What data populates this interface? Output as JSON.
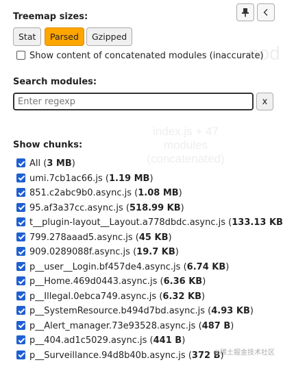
{
  "header": {
    "pin_icon": "pin-icon",
    "collapse_icon": "chevron-left-icon"
  },
  "treemap": {
    "title": "Treemap sizes:",
    "buttons": [
      {
        "label": "Stat",
        "active": false
      },
      {
        "label": "Parsed",
        "active": true
      },
      {
        "label": "Gzipped",
        "active": false
      }
    ],
    "concat_option": {
      "label": "Show content of concatenated modules (inaccurate)",
      "checked": false
    }
  },
  "search": {
    "title": "Search modules:",
    "placeholder": "Enter regexp",
    "value": "",
    "clear_label": "x"
  },
  "chunks": {
    "title": "Show chunks:",
    "items": [
      {
        "name": "All",
        "size": "3 MB",
        "checked": true
      },
      {
        "name": "umi.7cb1ac66.js",
        "size": "1.19 MB",
        "checked": true
      },
      {
        "name": "851.c2abc9b0.async.js",
        "size": "1.08 MB",
        "checked": true
      },
      {
        "name": "95.af3a37cc.async.js",
        "size": "518.99 KB",
        "checked": true
      },
      {
        "name": "t__plugin-layout__Layout.a778dbdc.async.js",
        "size": "133.13 KB",
        "checked": true
      },
      {
        "name": "799.278aaad5.async.js",
        "size": "45 KB",
        "checked": true
      },
      {
        "name": "909.0289088f.async.js",
        "size": "19.7 KB",
        "checked": true
      },
      {
        "name": "p__user__Login.bf457de4.async.js",
        "size": "6.74 KB",
        "checked": true
      },
      {
        "name": "p__Home.469d0443.async.js",
        "size": "6.36 KB",
        "checked": true
      },
      {
        "name": "p__Illegal.0ebca749.async.js",
        "size": "6.32 KB",
        "checked": true
      },
      {
        "name": "p__SystemResource.b494d7bd.async.js",
        "size": "4.93 KB",
        "checked": true
      },
      {
        "name": "p__Alert_manager.73e93528.async.js",
        "size": "487 B",
        "checked": true
      },
      {
        "name": "p__404.ad1c5029.async.js",
        "size": "441 B",
        "checked": true
      },
      {
        "name": "p__Surveillance.94d8b40b.async.js",
        "size": "372 B",
        "checked": true
      }
    ]
  },
  "background_ghost": {
    "line1": "index.js + 47",
    "line2": "modules",
    "line3": "(concatenated)",
    "right": "nod"
  },
  "watermark": "@稀土掘金技术社区",
  "colors": {
    "accent_active": "#ffa500",
    "checkbox": "#1f5fd1"
  }
}
